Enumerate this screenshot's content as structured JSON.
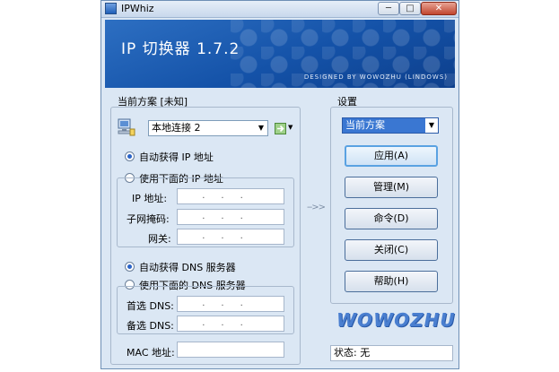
{
  "window": {
    "title": "IPWhiz",
    "min_label": "─",
    "max_label": "□",
    "close_label": "✕"
  },
  "banner": {
    "title": "IP 切换器 1.7.2",
    "credit": "DESIGNED BY WOWOZHU (LINDOWS)"
  },
  "left": {
    "group_title": "当前方案 [未知]",
    "adapter": "本地连接 2",
    "auto_ip_label": "自动获得 IP 地址",
    "manual_ip_label": "使用下面的 IP 地址",
    "ip_label": "IP 地址:",
    "mask_label": "子网掩码:",
    "gateway_label": "网关:",
    "auto_dns_label": "自动获得 DNS 服务器",
    "manual_dns_label": "使用下面的 DNS 服务器",
    "dns1_label": "首选 DNS:",
    "dns2_label": "备选 DNS:",
    "mac_label": "MAC 地址:",
    "ip_dots": "...",
    "auto_ip_selected": true,
    "auto_dns_selected": true
  },
  "right": {
    "group_title": "设置",
    "scheme": "当前方案",
    "buttons": [
      "应用(A)",
      "管理(M)",
      "命令(D)",
      "关闭(C)",
      "帮助(H)"
    ],
    "logo": "WOWOZHU",
    "status": "状态: 无"
  },
  "arrows": "-->>",
  "colors": {
    "banner": "#1452a8",
    "accent": "#2a64c8"
  }
}
